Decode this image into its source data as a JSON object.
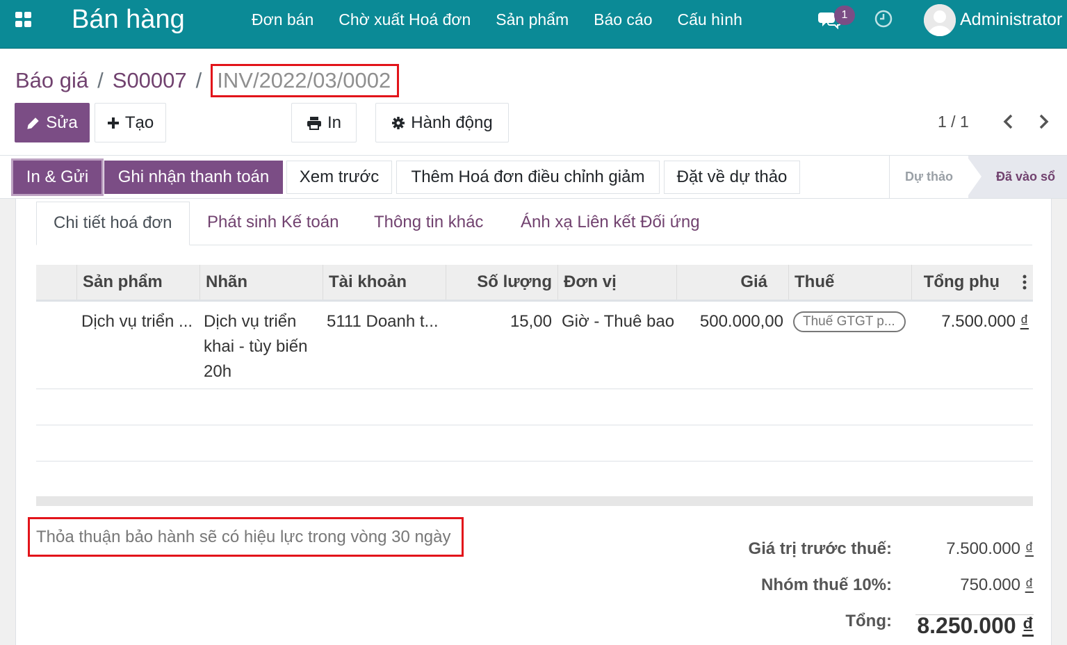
{
  "navbar": {
    "app_name": "Bán hàng",
    "menu": [
      "Đơn bán",
      "Chờ xuất Hoá đơn",
      "Sản phẩm",
      "Báo cáo",
      "Cấu hình"
    ],
    "message_count": "1",
    "user_name": "Administrator"
  },
  "breadcrumb": {
    "items": [
      "Báo giá",
      "S00007"
    ],
    "separator": "/",
    "current": "INV/2022/03/0002"
  },
  "toolbar": {
    "edit_label": "Sửa",
    "create_label": "Tạo",
    "print_label": "In",
    "action_label": "Hành động"
  },
  "pager": {
    "value": "1 / 1"
  },
  "statusbar": {
    "buttons": [
      "In & Gửi",
      "Ghi nhận thanh toán",
      "Xem trước",
      "Thêm Hoá đơn điều chỉnh giảm",
      "Đặt về dự thảo"
    ],
    "stages": [
      "Dự thảo",
      "Đã vào sổ"
    ],
    "active_stage": "Đã vào sổ"
  },
  "tabs": [
    "Chi tiết hoá đơn",
    "Phát sinh Kế toán",
    "Thông tin khác",
    "Ánh xạ Liên kết Đối ứng"
  ],
  "invoice_lines": {
    "columns": [
      "Sản phẩm",
      "Nhãn",
      "Tài khoản",
      "Số lượng",
      "Đơn vị",
      "Giá",
      "Thuế",
      "Tổng phụ"
    ],
    "rows": [
      {
        "product": "Dịch vụ triển ...",
        "label": "Dịch vụ triển khai - tùy biến 20h",
        "account": "5111 Doanh t...",
        "quantity": "15,00",
        "uom": "Giờ - Thuê bao",
        "price": "500.000,00",
        "tax": "Thuế GTGT p...",
        "subtotal": "7.500.000",
        "currency": "₫"
      }
    ]
  },
  "narration": "Thỏa thuận bảo hành sẽ có hiệu lực trong vòng 30 ngày",
  "totals": {
    "untaxed_label": "Giá trị trước thuế:",
    "untaxed_value": "7.500.000",
    "tax_label": "Nhóm thuế 10%:",
    "tax_value": "750.000",
    "total_label": "Tổng:",
    "total_value": "8.250.000",
    "currency": "₫"
  }
}
